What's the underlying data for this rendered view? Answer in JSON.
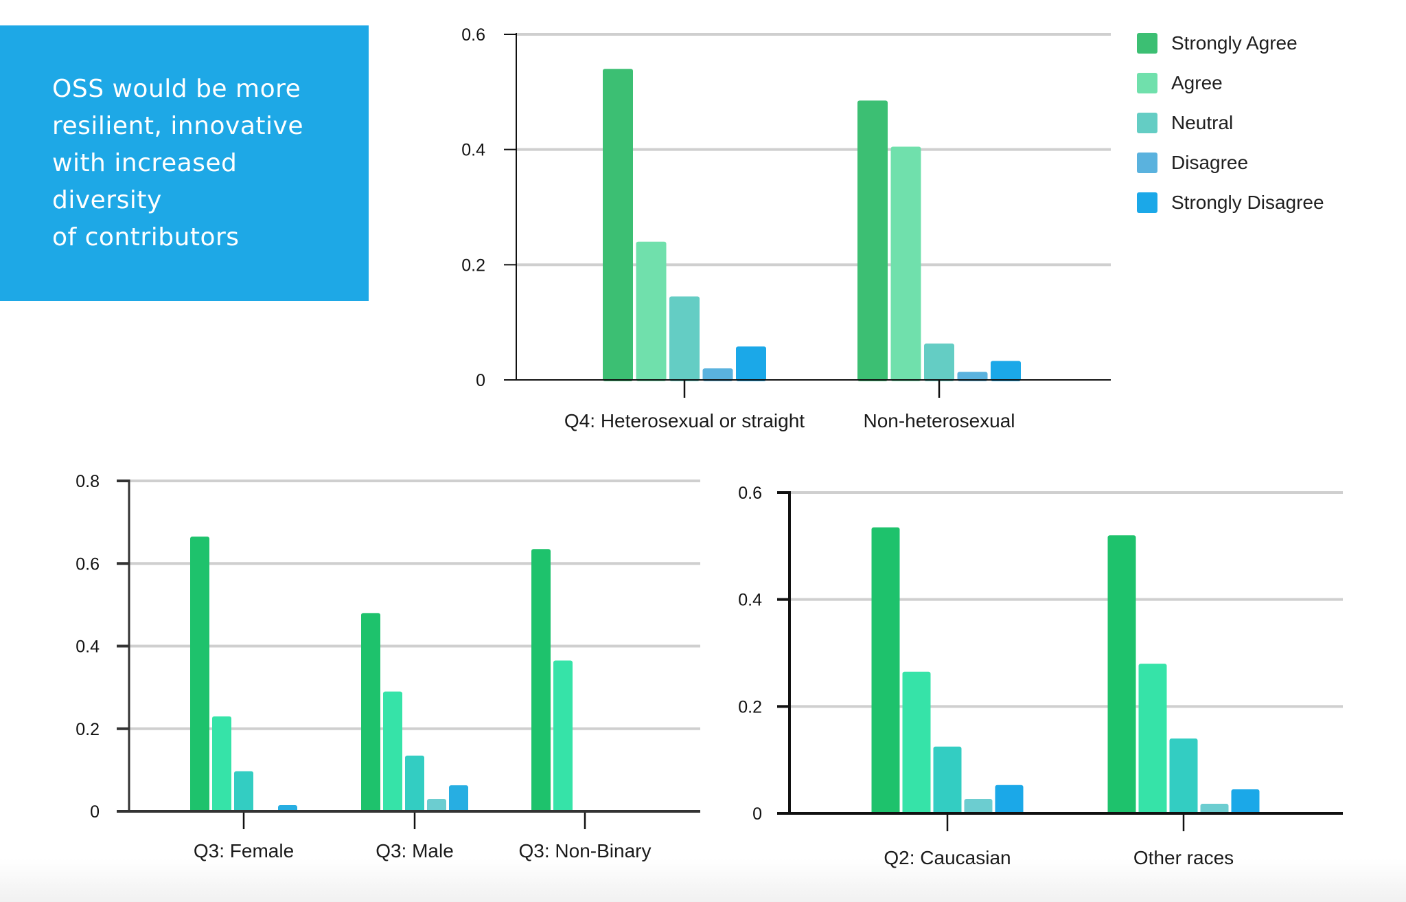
{
  "callout": {
    "lines": [
      "OSS would be more",
      "resilient, innovative",
      "with increased",
      "diversity",
      "of contributors"
    ],
    "background": "#1ea8e6"
  },
  "legend": {
    "placement": "top-right",
    "items": [
      {
        "label": "Strongly Agree",
        "color": "#3cbf73"
      },
      {
        "label": "Agree",
        "color": "#70e0ac"
      },
      {
        "label": "Neutral",
        "color": "#64cdc4"
      },
      {
        "label": "Disagree",
        "color": "#5ab2de"
      },
      {
        "label": "Strongly Disagree",
        "color": "#1ba8e8"
      }
    ]
  },
  "chart_data": [
    {
      "id": "sexual-orientation",
      "type": "bar",
      "title": "",
      "xlabel": "",
      "ylabel": "",
      "ylim": [
        0,
        0.6
      ],
      "yticks": [
        0,
        0.2,
        0.4,
        0.6
      ],
      "ytick_labels": [
        "0",
        "0.2",
        "0.4",
        "0.6"
      ],
      "grid": true,
      "categories": [
        "Q4: Heterosexual or straight",
        "Non-heterosexual"
      ],
      "series": [
        {
          "name": "Strongly Agree",
          "color": "#3cbf73",
          "values": [
            0.54,
            0.485
          ]
        },
        {
          "name": "Agree",
          "color": "#70e0ac",
          "values": [
            0.24,
            0.405
          ]
        },
        {
          "name": "Neutral",
          "color": "#64cdc4",
          "values": [
            0.145,
            0.063
          ]
        },
        {
          "name": "Disagree",
          "color": "#5ab2de",
          "values": [
            0.02,
            0.014
          ]
        },
        {
          "name": "Strongly Disagree",
          "color": "#1ba8e8",
          "values": [
            0.058,
            0.033
          ]
        }
      ]
    },
    {
      "id": "gender",
      "type": "bar",
      "title": "",
      "xlabel": "",
      "ylabel": "",
      "ylim": [
        0,
        0.8
      ],
      "yticks": [
        0,
        0.2,
        0.4,
        0.6,
        0.8
      ],
      "ytick_labels": [
        "0",
        "0.2",
        "0.4",
        "0.6",
        "0.8"
      ],
      "grid": true,
      "categories": [
        "Q3: Female",
        "Q3: Male",
        "Q3: Non-Binary"
      ],
      "series": [
        {
          "name": "Strongly Agree",
          "color": "#1ec26c",
          "values": [
            0.665,
            0.48,
            0.635
          ]
        },
        {
          "name": "Agree",
          "color": "#36e3a8",
          "values": [
            0.23,
            0.29,
            0.365
          ]
        },
        {
          "name": "Neutral",
          "color": "#33cdc2",
          "values": [
            0.097,
            0.135,
            0
          ]
        },
        {
          "name": "Disagree",
          "color": "#6ccdd0",
          "values": [
            0,
            0.03,
            0
          ]
        },
        {
          "name": "Strongly Disagree",
          "color": "#27aee2",
          "values": [
            0.015,
            0.063,
            0
          ]
        }
      ]
    },
    {
      "id": "race",
      "type": "bar",
      "title": "",
      "xlabel": "",
      "ylabel": "",
      "ylim": [
        0,
        0.6
      ],
      "yticks": [
        0,
        0.2,
        0.4,
        0.6
      ],
      "ytick_labels": [
        "0",
        "0.2",
        "0.4",
        "0.6"
      ],
      "grid": true,
      "categories": [
        "Q2: Caucasian",
        "Other races"
      ],
      "series": [
        {
          "name": "Strongly Agree",
          "color": "#1ec26c",
          "values": [
            0.535,
            0.52
          ]
        },
        {
          "name": "Agree",
          "color": "#36e3a8",
          "values": [
            0.265,
            0.28
          ]
        },
        {
          "name": "Neutral",
          "color": "#33cdc2",
          "values": [
            0.125,
            0.14
          ]
        },
        {
          "name": "Disagree",
          "color": "#6ccdd0",
          "values": [
            0.027,
            0.018
          ]
        },
        {
          "name": "Strongly Disagree",
          "color": "#1ba8e8",
          "values": [
            0.053,
            0.045
          ]
        }
      ]
    }
  ]
}
